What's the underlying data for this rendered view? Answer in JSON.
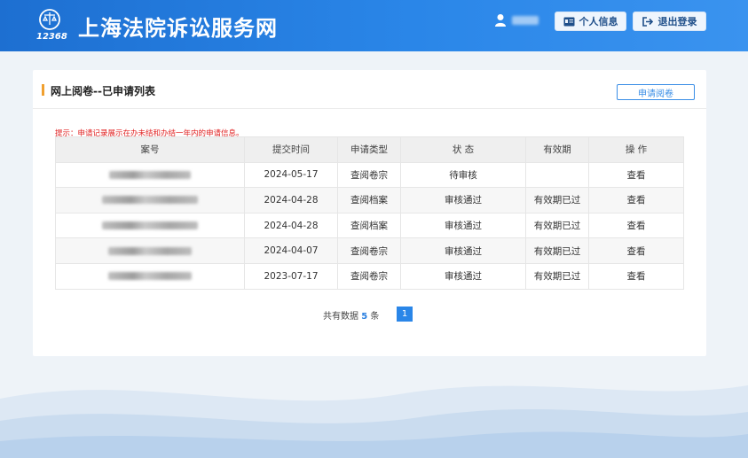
{
  "header": {
    "site_title": "上海法院诉讼服务网",
    "logo_text": "12368",
    "user_name": "",
    "profile_button": "个人信息",
    "logout_button": "退出登录"
  },
  "card": {
    "title": "网上阅卷--已申请列表",
    "apply_button": "申请阅卷",
    "hint": "提示：申请记录展示在办未结和办结一年内的申请信息。"
  },
  "table": {
    "columns": [
      "案号",
      "提交时间",
      "申请类型",
      "状 态",
      "有效期",
      "操 作"
    ],
    "rows": [
      {
        "case_no": "",
        "date": "2024-05-17",
        "type": "查阅卷宗",
        "status": "待审核",
        "status_kind": "pending",
        "validity": "",
        "action": "查看"
      },
      {
        "case_no": "",
        "date": "2024-04-28",
        "type": "查阅档案",
        "status": "审核通过",
        "status_kind": "pass",
        "validity": "有效期已过",
        "action": "查看"
      },
      {
        "case_no": "",
        "date": "2024-04-28",
        "type": "查阅档案",
        "status": "审核通过",
        "status_kind": "pass",
        "validity": "有效期已过",
        "action": "查看"
      },
      {
        "case_no": "",
        "date": "2024-04-07",
        "type": "查阅卷宗",
        "status": "审核通过",
        "status_kind": "pass",
        "validity": "有效期已过",
        "action": "查看"
      },
      {
        "case_no": "",
        "date": "2023-07-17",
        "type": "查阅卷宗",
        "status": "审核通过",
        "status_kind": "pass",
        "validity": "有效期已过",
        "action": "查看"
      }
    ]
  },
  "pagination": {
    "total_prefix": "共有数据",
    "total_count": "5",
    "total_suffix": "条",
    "current_page": "1"
  },
  "colors": {
    "header_blue": "#2a86e8",
    "accent_orange": "#f0a030",
    "status_red": "#e02020",
    "status_green": "#2e8b2e"
  }
}
